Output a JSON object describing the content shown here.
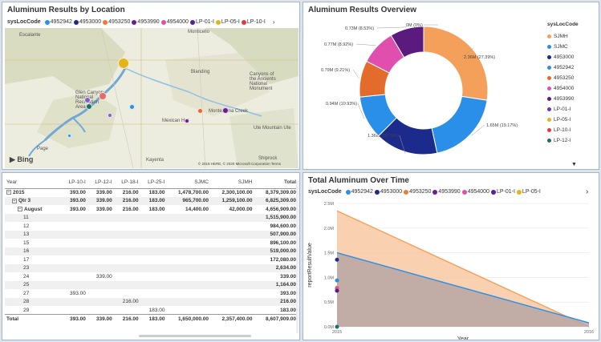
{
  "map": {
    "title": "Aluminum Results by Location",
    "legend_title": "sysLocCode",
    "legend_items": [
      {
        "label": "4952942",
        "color": "#2a8fe8"
      },
      {
        "label": "4953000",
        "color": "#1c2a8c"
      },
      {
        "label": "4953250",
        "color": "#f07a35"
      },
      {
        "label": "4953990",
        "color": "#6a1d91"
      },
      {
        "label": "4954000",
        "color": "#e04fae"
      },
      {
        "label": "LP-01-I",
        "color": "#5b1da0"
      },
      {
        "label": "LP-05-I",
        "color": "#e3b51a"
      },
      {
        "label": "LP-10-I",
        "color": "#e23b3b"
      }
    ],
    "places": [
      "Escalante",
      "Monticello",
      "Blanding",
      "Glen Canyon National Recreation Area",
      "Canyons of the Ancients National Monument",
      "Mexican Hat",
      "Montezuma Creek",
      "Ute Mountain Ute",
      "Page",
      "Kayenta",
      "Shiprock"
    ],
    "bing_label": "Bing",
    "copyright": "© 2018 HERE, © 2020 Microsoft Corporation  Terms"
  },
  "donut": {
    "title": "Aluminum Results Overview",
    "legend_title": "sysLocCode",
    "slices": [
      {
        "name": "SJMH",
        "value": 2.36,
        "label": "2.36M (27.39%)",
        "color": "#f5a05a"
      },
      {
        "name": "SJMC",
        "value": 1.65,
        "label": "1.65M (19.17%)",
        "color": "#2a8fe8"
      },
      {
        "name": "4953000",
        "value": 1.36,
        "label": "1.36M (15.79%)",
        "color": "#1c2a8c"
      },
      {
        "name": "4952942",
        "value": 0.94,
        "label": "0.94M (10.93%)",
        "color": "#2a8fe8"
      },
      {
        "name": "4953250",
        "value": 0.79,
        "label": "0.79M (9.21%)",
        "color": "#e36c2d"
      },
      {
        "name": "4954000",
        "value": 0.77,
        "label": "0.77M (8.92%)",
        "color": "#e04fae"
      },
      {
        "name": "4953990",
        "value": 0.73,
        "label": "0.73M (8.53%)",
        "color": "#5b1a7d"
      },
      {
        "name": "LP-01-I",
        "value": 0.0,
        "label": "0M (0%)",
        "color": "#6a35c0"
      }
    ],
    "legend_items": [
      {
        "label": "SJMH",
        "color": "#f5a05a"
      },
      {
        "label": "SJMC",
        "color": "#2a8fe8"
      },
      {
        "label": "4953000",
        "color": "#1c2a8c"
      },
      {
        "label": "4952942",
        "color": "#2a8fe8"
      },
      {
        "label": "4953250",
        "color": "#e36c2d"
      },
      {
        "label": "4954000",
        "color": "#e04fae"
      },
      {
        "label": "4953990",
        "color": "#5b1a7d"
      },
      {
        "label": "LP-01-I",
        "color": "#6a35c0"
      },
      {
        "label": "LP-05-I",
        "color": "#e3b51a"
      },
      {
        "label": "LP-10-I",
        "color": "#e23b3b"
      },
      {
        "label": "LP-12-I",
        "color": "#1f6f6a"
      }
    ],
    "scroll_glyph": "▼"
  },
  "table": {
    "columns": [
      "Year",
      "LP-10-I",
      "LP-12-I",
      "LP-18-I",
      "LP-25-I",
      "SJMC",
      "SJMH",
      "Total"
    ],
    "rows": [
      {
        "label": "2015",
        "indent": 0,
        "expander": "−",
        "bold": true,
        "cells": [
          "393.00",
          "339.00",
          "216.00",
          "183.00",
          "1,478,700.00",
          "2,300,100.00",
          "8,379,309.00"
        ]
      },
      {
        "label": "Qtr 3",
        "indent": 1,
        "expander": "−",
        "bold": true,
        "cells": [
          "393.00",
          "339.00",
          "216.00",
          "183.00",
          "965,700.00",
          "1,259,100.00",
          "6,825,309.00"
        ]
      },
      {
        "label": "August",
        "indent": 2,
        "expander": "−",
        "bold": true,
        "cells": [
          "393.00",
          "339.00",
          "216.00",
          "183.00",
          "14,400.00",
          "42,000.00",
          "4,656,909.00"
        ]
      },
      {
        "label": "11",
        "indent": 3,
        "expander": "",
        "bold": false,
        "cells": [
          "",
          "",
          "",
          "",
          "",
          "",
          "1,515,900.00"
        ]
      },
      {
        "label": "12",
        "indent": 3,
        "expander": "",
        "bold": false,
        "cells": [
          "",
          "",
          "",
          "",
          "",
          "",
          "984,600.00"
        ]
      },
      {
        "label": "13",
        "indent": 3,
        "expander": "",
        "bold": false,
        "cells": [
          "",
          "",
          "",
          "",
          "",
          "",
          "507,900.00"
        ]
      },
      {
        "label": "15",
        "indent": 3,
        "expander": "",
        "bold": false,
        "cells": [
          "",
          "",
          "",
          "",
          "",
          "",
          "896,100.00"
        ]
      },
      {
        "label": "16",
        "indent": 3,
        "expander": "",
        "bold": false,
        "cells": [
          "",
          "",
          "",
          "",
          "",
          "",
          "519,000.00"
        ]
      },
      {
        "label": "17",
        "indent": 3,
        "expander": "",
        "bold": false,
        "cells": [
          "",
          "",
          "",
          "",
          "",
          "",
          "172,080.00"
        ]
      },
      {
        "label": "23",
        "indent": 3,
        "expander": "",
        "bold": false,
        "cells": [
          "",
          "",
          "",
          "",
          "",
          "",
          "2,634.00"
        ]
      },
      {
        "label": "24",
        "indent": 3,
        "expander": "",
        "bold": false,
        "cells": [
          "",
          "339.00",
          "",
          "",
          "",
          "",
          "339.00"
        ]
      },
      {
        "label": "25",
        "indent": 3,
        "expander": "",
        "bold": false,
        "cells": [
          "",
          "",
          "",
          "",
          "",
          "",
          "1,164.00"
        ]
      },
      {
        "label": "27",
        "indent": 3,
        "expander": "",
        "bold": false,
        "cells": [
          "393.00",
          "",
          "",
          "",
          "",
          "",
          "393.00"
        ]
      },
      {
        "label": "28",
        "indent": 3,
        "expander": "",
        "bold": false,
        "cells": [
          "",
          "",
          "216.00",
          "",
          "",
          "",
          "216.00"
        ]
      },
      {
        "label": "29",
        "indent": 3,
        "expander": "",
        "bold": false,
        "cells": [
          "",
          "",
          "",
          "183.00",
          "",
          "",
          "183.00"
        ]
      }
    ],
    "total": {
      "label": "Total",
      "cells": [
        "393.00",
        "339.00",
        "216.00",
        "183.00",
        "1,650,000.00",
        "2,357,400.00",
        "8,607,909.00"
      ]
    }
  },
  "area": {
    "title": "Total Aluminum Over Time",
    "legend_title": "sysLocCode",
    "legend_items": [
      {
        "label": "4952942",
        "color": "#2a8fe8"
      },
      {
        "label": "4953000",
        "color": "#1c2a8c"
      },
      {
        "label": "4953250",
        "color": "#f07a35"
      },
      {
        "label": "4953990",
        "color": "#6a1d91"
      },
      {
        "label": "4954000",
        "color": "#e04fae"
      },
      {
        "label": "LP-01-I",
        "color": "#5b1da0"
      },
      {
        "label": "LP-05-I",
        "color": "#e3b51a"
      }
    ],
    "more_glyph": "›"
  },
  "chart_data": {
    "type": "area",
    "title": "Total Aluminum Over Time",
    "xlabel": "Year",
    "ylabel": "reportResultValue",
    "x": [
      2015,
      2016
    ],
    "ylim": [
      0,
      2500000
    ],
    "yticks": [
      0,
      500000,
      1000000,
      1500000,
      2000000,
      2500000
    ],
    "ytick_labels": [
      "0.0M",
      "0.5M",
      "1.0M",
      "1.5M",
      "2.0M",
      "2.5M"
    ],
    "series": [
      {
        "name": "SJMH",
        "values": [
          2350000,
          0
        ],
        "color": "#f5a05a",
        "fill": "#f8c9a3"
      },
      {
        "name": "SJMC",
        "values": [
          1500000,
          80000
        ],
        "color": "#2a8fe8",
        "fill": "#b9a6a4"
      }
    ],
    "points_2015": [
      {
        "value": 1360000,
        "color": "#1c2a8c"
      },
      {
        "value": 940000,
        "color": "#2a8fe8"
      },
      {
        "value": 790000,
        "color": "#e36c2d"
      },
      {
        "value": 770000,
        "color": "#e04fae"
      },
      {
        "value": 730000,
        "color": "#5b1a7d"
      },
      {
        "value": 0,
        "color": "#1f6f6a"
      }
    ],
    "grid": true
  }
}
